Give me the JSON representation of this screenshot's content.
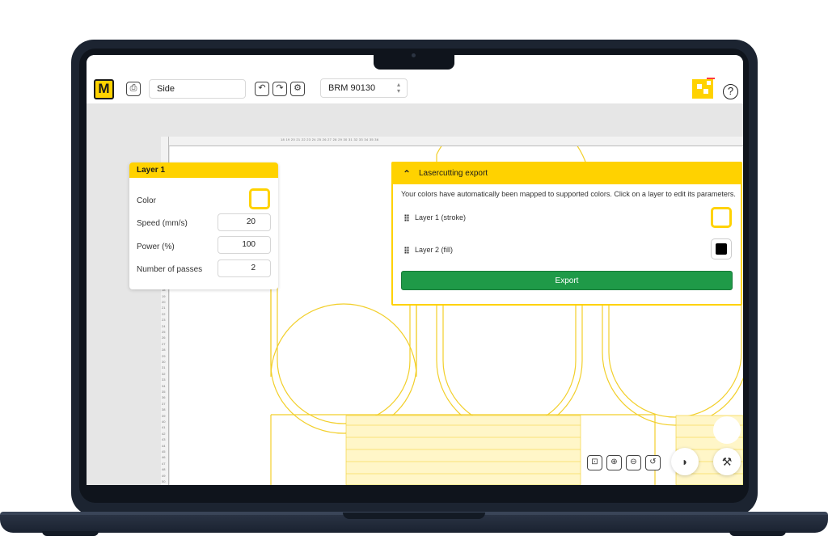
{
  "header": {
    "logo_text": "M",
    "document_name": "Side",
    "material": "BRM 90130"
  },
  "layer_panel": {
    "title": "Layer 1",
    "color_label": "Color",
    "speed_label": "Speed (mm/s)",
    "speed_value": "20",
    "power_label": "Power (%)",
    "power_value": "100",
    "passes_label": "Number of passes",
    "passes_value": "2"
  },
  "export_panel": {
    "title": "Lasercutting export",
    "description": "Your colors have automatically been mapped to supported colors. Click on a layer to edit its parameters.",
    "layers": [
      {
        "label": "Layer 1 (stroke)",
        "color": "#ffd200"
      },
      {
        "label": "Layer 2 (fill)",
        "color": "#000000"
      }
    ],
    "export_label": "Export"
  },
  "ruler": {
    "top_ticks": "18 19 20 21 22 23 24 25 26 27 28 29 30 31 32 33 34 35 36",
    "left_ticks": [
      "15",
      "16",
      "17",
      "18",
      "19",
      "20",
      "21",
      "22",
      "23",
      "24",
      "25",
      "26",
      "27",
      "28",
      "29",
      "30",
      "31",
      "32",
      "33",
      "34",
      "35",
      "36",
      "37",
      "38",
      "39",
      "40",
      "41",
      "42",
      "43",
      "44",
      "45",
      "46",
      "47",
      "48",
      "49",
      "50",
      "51",
      "52",
      "53"
    ]
  },
  "colors": {
    "accent": "#ffd200",
    "export_green": "#1f9a48",
    "canvas_bg": "#e6e6e6"
  },
  "icons": [
    "logo-icon",
    "file-icon",
    "undo-icon",
    "redo-icon",
    "settings-icon",
    "help-icon",
    "brand-icon",
    "tape-measure-icon",
    "zoom-in-icon",
    "zoom-out-icon",
    "reset-view-icon",
    "preview-icon",
    "laser-icon",
    "drag-handle-icon"
  ]
}
